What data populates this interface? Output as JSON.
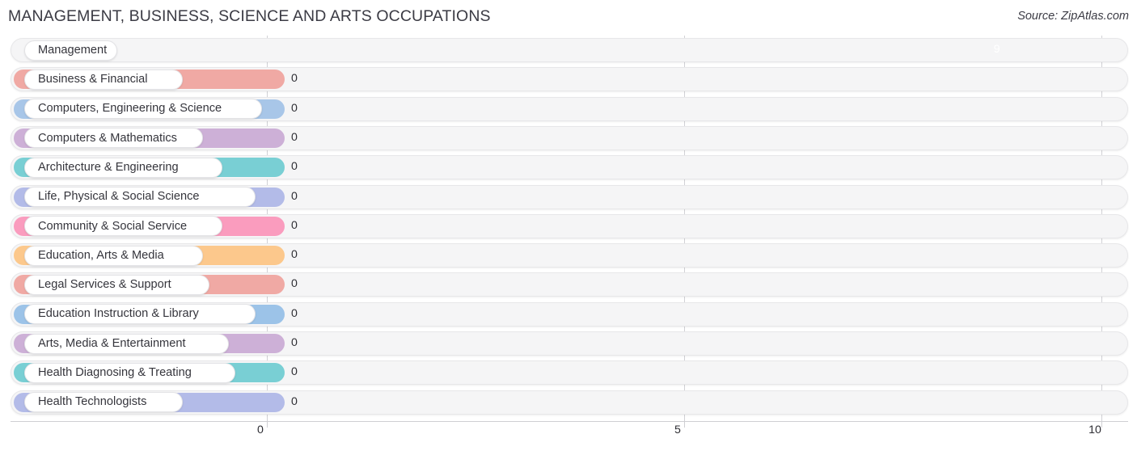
{
  "header": {
    "title": "MANAGEMENT, BUSINESS, SCIENCE AND ARTS OCCUPATIONS",
    "source": "Source: ZipAtlas.com"
  },
  "axis": {
    "ticks": [
      {
        "label": "0",
        "value": 0
      },
      {
        "label": "5",
        "value": 5
      },
      {
        "label": "10",
        "value": 10
      }
    ]
  },
  "chart_data": {
    "type": "bar",
    "orientation": "horizontal",
    "title": "MANAGEMENT, BUSINESS, SCIENCE AND ARTS OCCUPATIONS",
    "subtitle": "",
    "source": "Source: ZipAtlas.com",
    "xlabel": "",
    "ylabel": "",
    "xlim": [
      0,
      10
    ],
    "xticks": [
      0,
      5,
      10
    ],
    "xtick_labels": [
      "0",
      "5",
      "10"
    ],
    "grid": true,
    "legend": false,
    "categories": [
      "Management",
      "Business & Financial",
      "Computers, Engineering & Science",
      "Computers & Mathematics",
      "Architecture & Engineering",
      "Life, Physical & Social Science",
      "Community & Social Service",
      "Education, Arts & Media",
      "Legal Services & Support",
      "Education Instruction & Library",
      "Arts, Media & Entertainment",
      "Health Diagnosing & Treating",
      "Health Technologists"
    ],
    "values": [
      9,
      0,
      0,
      0,
      0,
      0,
      0,
      0,
      0,
      0,
      0,
      0,
      0
    ],
    "value_labels": [
      "9",
      "0",
      "0",
      "0",
      "0",
      "0",
      "0",
      "0",
      "0",
      "0",
      "0",
      "0",
      "0"
    ],
    "colors": [
      "#f9a košice"
    ]
  },
  "rows": [
    {
      "label": "Management",
      "value": 9,
      "value_label": "9",
      "color": "#f9a council"
    },
    {
      "label": "Business & Financial",
      "value": 0,
      "value_label": "0",
      "color": "#f0a9a4"
    },
    {
      "label": "Computers, Engineering & Science",
      "value": 0,
      "value_label": "0",
      "color": "#a8c6e8"
    },
    {
      "label": "Computers & Mathematics",
      "value": 0,
      "value_label": "0",
      "color": "#cdb0d7"
    },
    {
      "label": "Architecture & Engineering",
      "value": 0,
      "value_label": "0",
      "color": "#79cfd4"
    },
    {
      "label": "Life, Physical & Social Science",
      "value": 0,
      "value_label": "0",
      "color": "#b3bbe8"
    },
    {
      "label": "Community & Social Service",
      "value": 0,
      "value_label": "0",
      "color": "#fa9cbe"
    },
    {
      "label": "Education, Arts & Media",
      "value": 0,
      "value_label": "0",
      "color": "#fcc88c"
    },
    {
      "label": "Legal Services & Support",
      "value": 0,
      "value_label": "0",
      "color": "#f0a9a4"
    },
    {
      "label": "Education Instruction & Library",
      "value": 0,
      "value_label": "0",
      "color": "#9cc3e8"
    },
    {
      "label": "Arts, Media & Entertainment",
      "value": 0,
      "value_label": "0",
      "color": "#cdb0d7"
    },
    {
      "label": "Health Diagnosing & Treating",
      "value": 0,
      "value_label": "0",
      "color": "#79cfd4"
    },
    {
      "label": "Health Technologists",
      "value": 0,
      "value_label": "0",
      "color": "#b3bbe8"
    }
  ],
  "style": {
    "bar_orange": "#f9a council"
  }
}
